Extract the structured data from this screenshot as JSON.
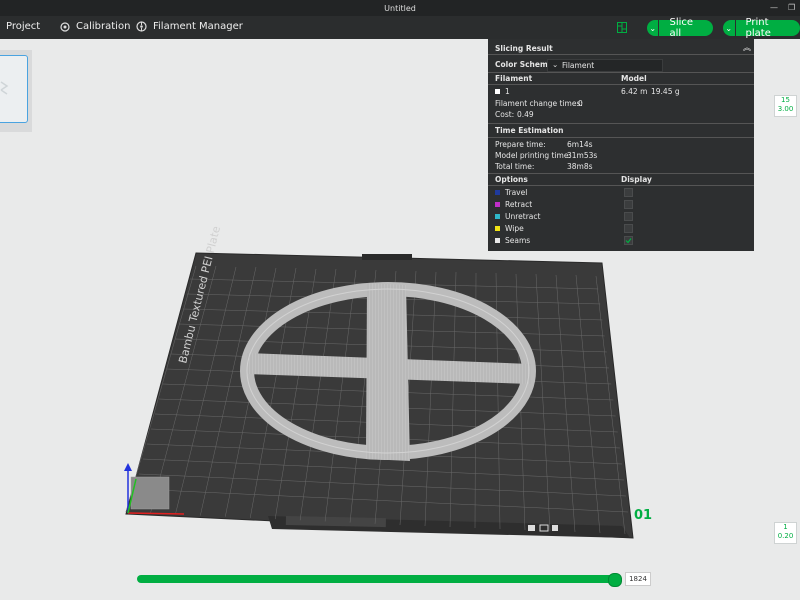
{
  "window": {
    "title": "Untitled"
  },
  "toolbar": {
    "project_label": "Project",
    "calibration_label": "Calibration",
    "filament_manager_label": "Filament Manager",
    "slice_all_label": "Slice all",
    "print_plate_label": "Print plate",
    "icons": [
      "calibration-icon",
      "filament-manager-icon",
      "layout-icon",
      "dropdown-arrow-icon"
    ]
  },
  "slicing_result": {
    "title": "Slicing Result",
    "color_scheme_label": "Color Scheme",
    "color_scheme_value": "Filament",
    "filament_header": "Filament",
    "model_header": "Model",
    "filament_index": "1",
    "filament_length": "6.42 m",
    "filament_weight": "19.45 g",
    "filament_change_label": "Filament change times:",
    "filament_change_value": "0",
    "cost_label": "Cost:",
    "cost_value": "0.49",
    "time_header": "Time Estimation",
    "prepare_label": "Prepare time:",
    "prepare_value": "6m14s",
    "model_print_label": "Model printing time:",
    "model_print_value": "31m53s",
    "total_label": "Total time:",
    "total_value": "38m8s",
    "options_header": "Options",
    "display_header": "Display",
    "options": [
      {
        "label": "Travel",
        "color": "#1f3a9e",
        "checked": false
      },
      {
        "label": "Retract",
        "color": "#c02ec8",
        "checked": false
      },
      {
        "label": "Unretract",
        "color": "#2fb7c8",
        "checked": false
      },
      {
        "label": "Wipe",
        "color": "#f2e416",
        "checked": false
      },
      {
        "label": "Seams",
        "color": "#e8e8e8",
        "checked": true
      }
    ]
  },
  "layer_range": {
    "top_layer": "15",
    "top_height": "3.00",
    "bottom_layer": "1",
    "bottom_height": "0.20"
  },
  "plate": {
    "name": "Bambu Textured PEI Plate",
    "number": "01"
  },
  "slider": {
    "value": "1824",
    "fraction": 1.0
  },
  "colors": {
    "accent": "#00ae42",
    "panel": "#2d2f30",
    "toolbar": "#2b2d2e"
  }
}
